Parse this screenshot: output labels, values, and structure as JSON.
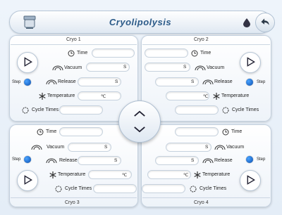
{
  "header": {
    "title": "Cryolipolysis",
    "logo_icon": "device-icon",
    "water_icon": "water-drop-icon",
    "back_icon": "back-arrow-icon"
  },
  "labels": {
    "time": "Time",
    "vacuum": "Vacuum",
    "release": "Release",
    "temperature": "Temperature",
    "cycle_times": "Cycle Times",
    "step": "Step",
    "unit_s": "S",
    "unit_c": "℃"
  },
  "panels": [
    {
      "title": "Cryo 1"
    },
    {
      "title": "Cryo 2"
    },
    {
      "title": "Cryo 3"
    },
    {
      "title": "Cryo 4"
    }
  ],
  "colors": {
    "accent": "#2b5a88",
    "step_dot": "#0a4fb0"
  }
}
